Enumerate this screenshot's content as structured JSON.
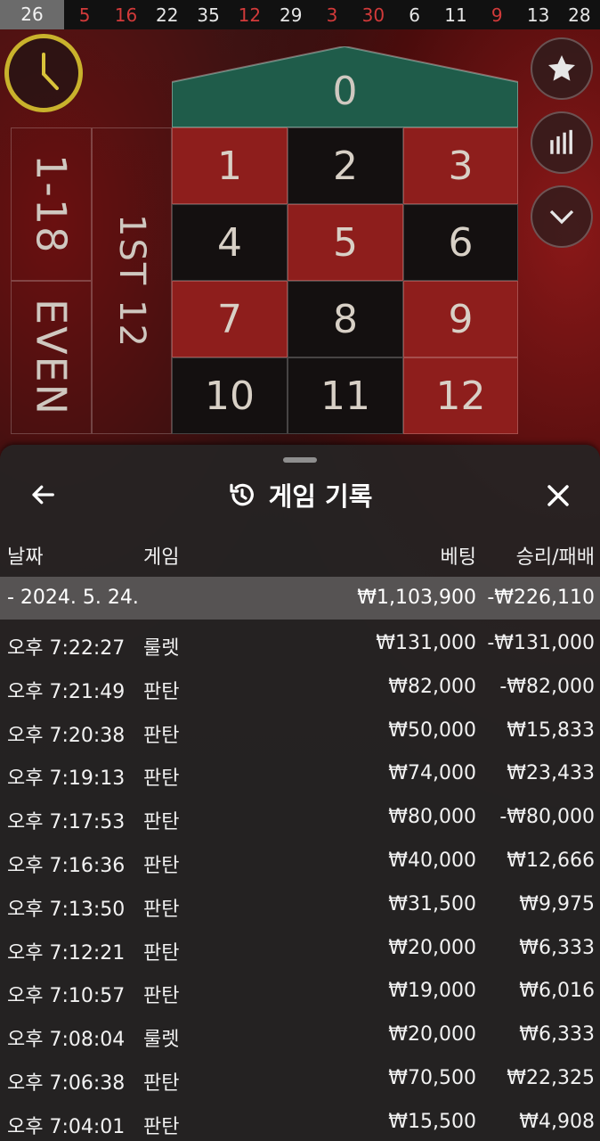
{
  "history": {
    "current": "26",
    "numbers": [
      {
        "v": "5",
        "red": true
      },
      {
        "v": "16",
        "red": true
      },
      {
        "v": "22",
        "red": false
      },
      {
        "v": "35",
        "red": false
      },
      {
        "v": "12",
        "red": true
      },
      {
        "v": "29",
        "red": false
      },
      {
        "v": "3",
        "red": true
      },
      {
        "v": "30",
        "red": true
      },
      {
        "v": "6",
        "red": false
      },
      {
        "v": "11",
        "red": false
      },
      {
        "v": "9",
        "red": true
      },
      {
        "v": "13",
        "red": false
      },
      {
        "v": "28",
        "red": false
      }
    ]
  },
  "board": {
    "zero": "0",
    "rows": [
      [
        {
          "n": "1",
          "c": "red"
        },
        {
          "n": "2",
          "c": "black"
        },
        {
          "n": "3",
          "c": "red"
        }
      ],
      [
        {
          "n": "4",
          "c": "black"
        },
        {
          "n": "5",
          "c": "red"
        },
        {
          "n": "6",
          "c": "black"
        }
      ],
      [
        {
          "n": "7",
          "c": "red"
        },
        {
          "n": "8",
          "c": "black"
        },
        {
          "n": "9",
          "c": "red"
        }
      ],
      [
        {
          "n": "10",
          "c": "black"
        },
        {
          "n": "11",
          "c": "black"
        },
        {
          "n": "12",
          "c": "red"
        }
      ]
    ],
    "low_label": "1-18",
    "even_label": "EVEN",
    "dozen_label": "1ST 12"
  },
  "sheet": {
    "title": "게임 기록",
    "columns": {
      "date": "날짜",
      "game": "게임",
      "bet": "베팅",
      "result": "승리/패배"
    },
    "summary": {
      "date": "- 2024. 5. 24.",
      "bet": "₩1,103,900",
      "result": "-₩226,110"
    },
    "rows": [
      {
        "time": "오후 7:22:27",
        "game": "룰렛",
        "bet": "₩131,000",
        "result": "-₩131,000"
      },
      {
        "time": "오후 7:21:49",
        "game": "판탄",
        "bet": "₩82,000",
        "result": "-₩82,000"
      },
      {
        "time": "오후 7:20:38",
        "game": "판탄",
        "bet": "₩50,000",
        "result": "₩15,833"
      },
      {
        "time": "오후 7:19:13",
        "game": "판탄",
        "bet": "₩74,000",
        "result": "₩23,433"
      },
      {
        "time": "오후 7:17:53",
        "game": "판탄",
        "bet": "₩80,000",
        "result": "-₩80,000"
      },
      {
        "time": "오후 7:16:36",
        "game": "판탄",
        "bet": "₩40,000",
        "result": "₩12,666"
      },
      {
        "time": "오후 7:13:50",
        "game": "판탄",
        "bet": "₩31,500",
        "result": "₩9,975"
      },
      {
        "time": "오후 7:12:21",
        "game": "판탄",
        "bet": "₩20,000",
        "result": "₩6,333"
      },
      {
        "time": "오후 7:10:57",
        "game": "판탄",
        "bet": "₩19,000",
        "result": "₩6,016"
      },
      {
        "time": "오후 7:08:04",
        "game": "룰렛",
        "bet": "₩20,000",
        "result": "₩6,333"
      },
      {
        "time": "오후 7:06:38",
        "game": "판탄",
        "bet": "₩70,500",
        "result": "₩22,325"
      },
      {
        "time": "오후 7:04:01",
        "game": "판탄",
        "bet": "₩15,500",
        "result": "₩4,908"
      }
    ]
  },
  "colors": {
    "accent_gold": "#c9b22c",
    "red": "#8e1e1c",
    "black": "#141010",
    "green": "#1f5c4a"
  },
  "icons": [
    "clock-icon",
    "star-icon",
    "stats-icon",
    "chevron-down-icon",
    "back-arrow-icon",
    "history-icon",
    "close-icon"
  ]
}
